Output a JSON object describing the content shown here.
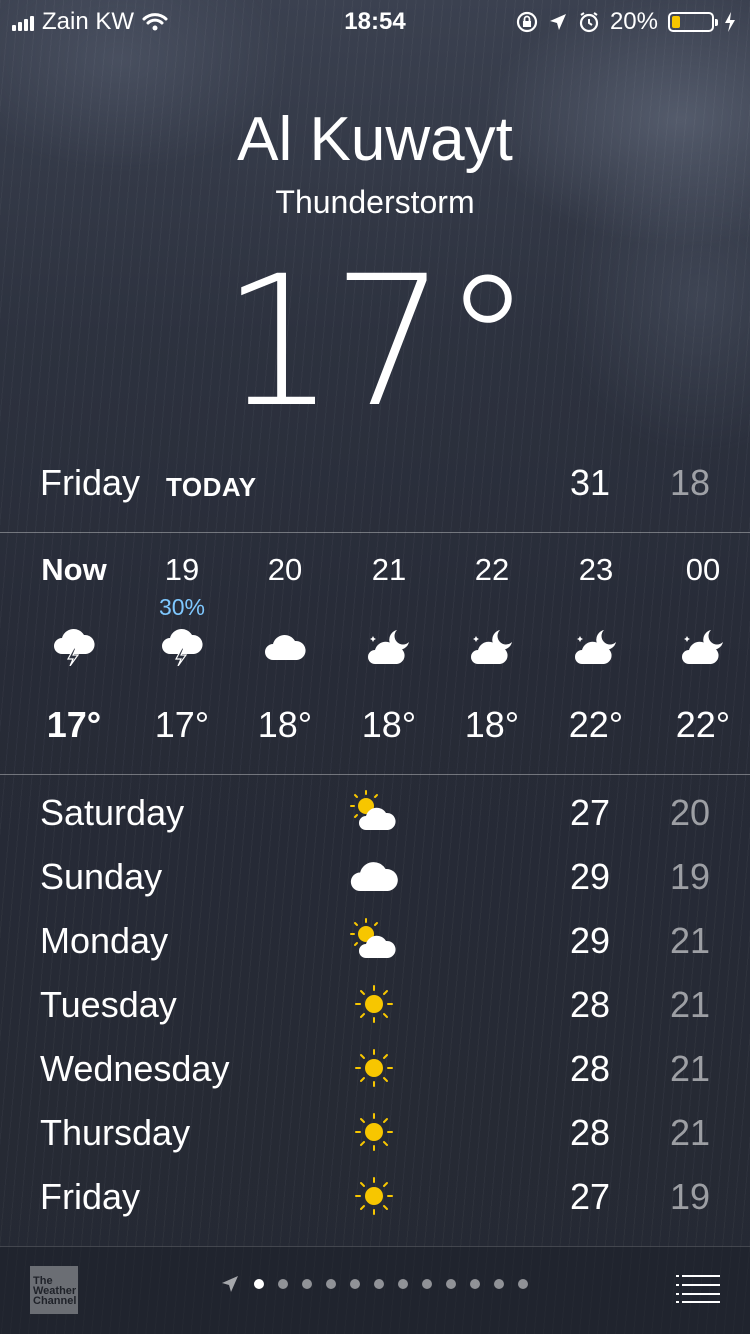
{
  "status": {
    "carrier": "Zain KW",
    "time": "18:54",
    "battery": "20%",
    "battery_level": 0.2,
    "battery_color": "#f7c600"
  },
  "location": {
    "city": "Al Kuwayt",
    "condition": "Thunderstorm",
    "temperature": "17°"
  },
  "today": {
    "day": "Friday",
    "tag": "TODAY",
    "high": "31",
    "low": "18"
  },
  "hourly": [
    {
      "time": "Now",
      "precip": "",
      "icon": "thunderstorm-icon",
      "temp": "17°",
      "bold": true
    },
    {
      "time": "19",
      "precip": "30%",
      "icon": "thunderstorm-icon",
      "temp": "17°",
      "bold": false
    },
    {
      "time": "20",
      "precip": "",
      "icon": "cloud-icon",
      "temp": "18°",
      "bold": false
    },
    {
      "time": "21",
      "precip": "",
      "icon": "partly-cloudy-night-icon",
      "temp": "18°",
      "bold": false
    },
    {
      "time": "22",
      "precip": "",
      "icon": "partly-cloudy-night-icon",
      "temp": "18°",
      "bold": false
    },
    {
      "time": "23",
      "precip": "",
      "icon": "partly-cloudy-night-icon",
      "temp": "22°",
      "bold": false
    },
    {
      "time": "00",
      "precip": "",
      "icon": "partly-cloudy-night-icon",
      "temp": "22°",
      "bold": false
    }
  ],
  "daily": [
    {
      "day": "Saturday",
      "icon": "partly-sunny-icon",
      "high": "27",
      "low": "20"
    },
    {
      "day": "Sunday",
      "icon": "cloud-icon",
      "high": "29",
      "low": "19"
    },
    {
      "day": "Monday",
      "icon": "partly-sunny-icon",
      "high": "29",
      "low": "21"
    },
    {
      "day": "Tuesday",
      "icon": "sun-icon",
      "high": "28",
      "low": "21"
    },
    {
      "day": "Wednesday",
      "icon": "sun-icon",
      "high": "28",
      "low": "21"
    },
    {
      "day": "Thursday",
      "icon": "sun-icon",
      "high": "28",
      "low": "21"
    },
    {
      "day": "Friday",
      "icon": "sun-icon",
      "high": "27",
      "low": "19"
    }
  ],
  "footer": {
    "logo_text": "The Weather Channel",
    "page_count": 12,
    "active_page": 0
  }
}
